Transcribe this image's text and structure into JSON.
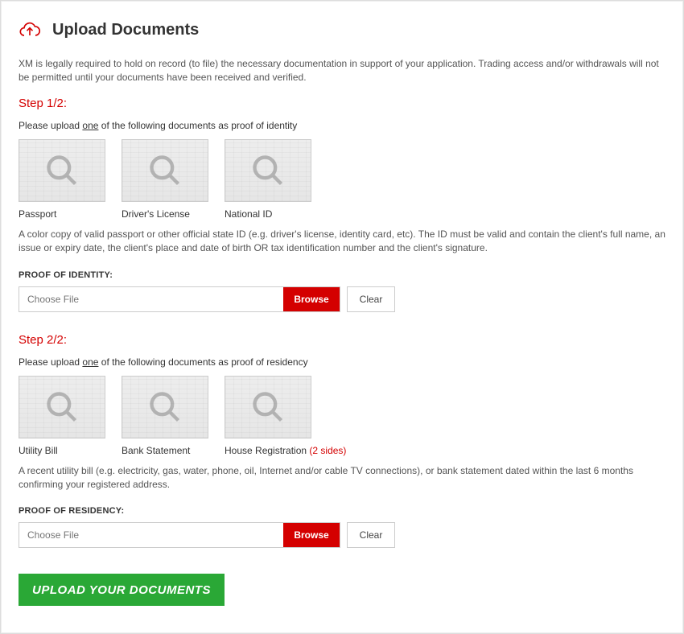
{
  "header": {
    "title": "Upload Documents"
  },
  "intro": "XM is legally required to hold on record (to file) the necessary documentation in support of your application. Trading access and/or withdrawals will not be permitted until your documents have been received and verified.",
  "step1": {
    "title": "Step 1/2:",
    "instruction_pre": "Please upload ",
    "instruction_underline": "one",
    "instruction_post": " of the following documents as proof of identity",
    "docs": [
      {
        "label": "Passport"
      },
      {
        "label": "Driver's License"
      },
      {
        "label": "National ID"
      }
    ],
    "description": "A color copy of valid passport or other official state ID (e.g. driver's license, identity card, etc). The ID must be valid and contain the client's full name, an issue or expiry date, the client's place and date of birth OR tax identification number and the client's signature.",
    "field_label": "PROOF OF IDENTITY:",
    "placeholder": "Choose File",
    "browse": "Browse",
    "clear": "Clear"
  },
  "step2": {
    "title": "Step 2/2:",
    "instruction_pre": "Please upload ",
    "instruction_underline": "one",
    "instruction_post": " of the following documents as proof of residency",
    "docs": [
      {
        "label": "Utility Bill",
        "suffix": ""
      },
      {
        "label": "Bank Statement",
        "suffix": ""
      },
      {
        "label": "House Registration",
        "suffix": " (2 sides)"
      }
    ],
    "description": "A recent utility bill (e.g. electricity, gas, water, phone, oil, Internet and/or cable TV connections), or bank statement dated within the last 6 months confirming your registered address.",
    "field_label": "PROOF OF RESIDENCY:",
    "placeholder": "Choose File",
    "browse": "Browse",
    "clear": "Clear"
  },
  "submit": "UPLOAD YOUR DOCUMENTS"
}
